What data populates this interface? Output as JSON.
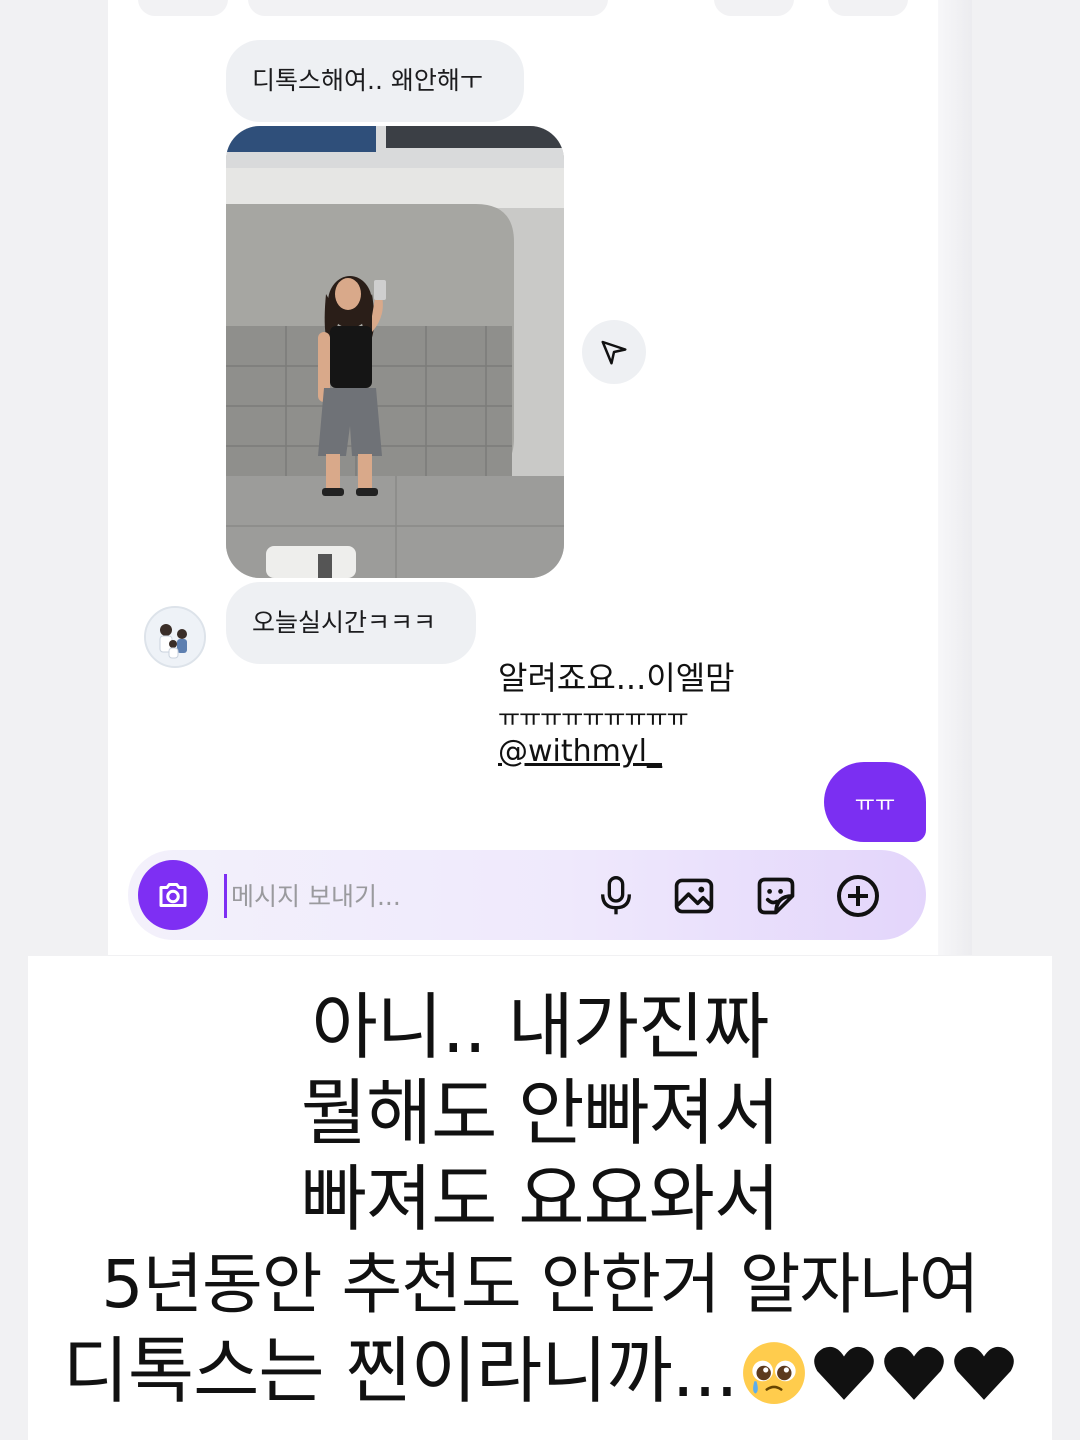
{
  "chat": {
    "message_1": "디톡스해여.. 왜안해ㅜ",
    "message_2": "오늘실시간ㅋㅋㅋ",
    "sticker": {
      "line1": "알려죠요...이엘맘",
      "line2": "ㅠㅠㅠㅠㅠㅠㅠㅠㅠ",
      "handle": "@withmyl_"
    },
    "outgoing": "ㅠㅠ"
  },
  "composer": {
    "placeholder": "메시지 보내기..."
  },
  "icons": {
    "share": "send-icon",
    "camera": "camera-icon",
    "mic": "microphone-icon",
    "gallery": "image-icon",
    "sticker": "sticker-icon",
    "add": "plus-circle-icon"
  },
  "caption": {
    "line1": "아니.. 내가진짜",
    "line2": "뭘해도 안빠져서",
    "line3": "빠져도 요요와서",
    "line4": "5년동안 추천도 안한거 알자나여",
    "line5": "디톡스는 찐이라니까..."
  },
  "colors": {
    "accent": "#7b2ff2",
    "incoming_bubble": "#eef0f3"
  }
}
